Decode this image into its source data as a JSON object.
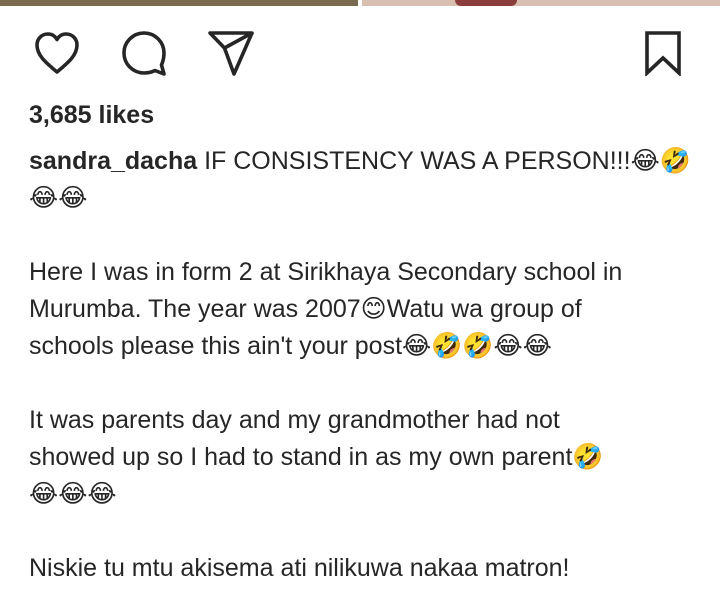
{
  "post": {
    "likes_text": "3,685 likes",
    "username": "sandra_dacha",
    "caption_lines": [
      "IF CONSISTENCY WAS A PERSON!!!😂🤣😂😂",
      "",
      " Here I was in form 2 at Sirikhaya Secondary school in",
      "Murumba. The year was 2007😊Watu wa group of",
      "schools please this ain't your post😂🤣🤣😂😂",
      "",
      " It was parents day and my grandmother had not",
      "showed up so I had to stand in as my own parent🤣",
      "😂😂😂",
      "",
      " Niskie tu mtu akisema ati nilikuwa nakaa matron!"
    ]
  },
  "icons": {
    "like": "heart-icon",
    "comment": "comment-bubble-icon",
    "share": "paper-plane-icon",
    "save": "bookmark-icon"
  },
  "colors": {
    "text": "#262626",
    "icon": "#262626",
    "background": "#ffffff"
  }
}
